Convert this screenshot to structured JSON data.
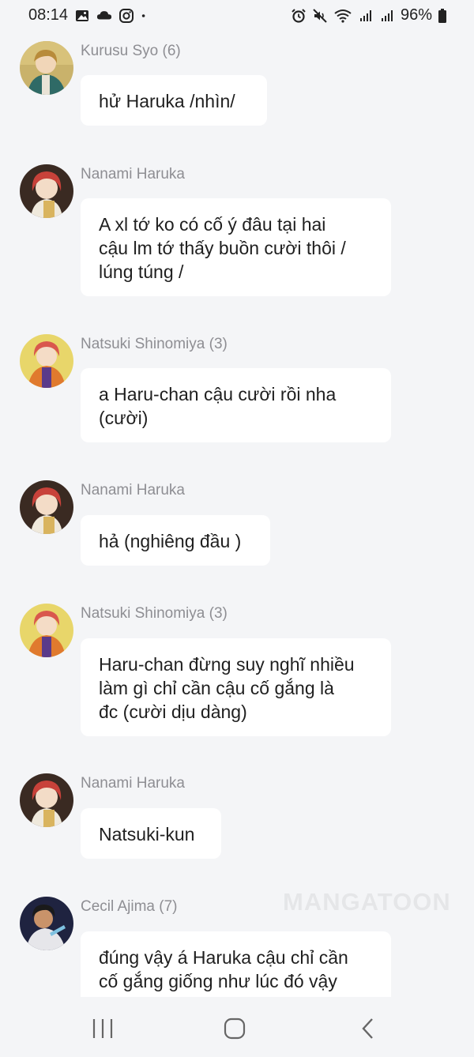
{
  "status_bar": {
    "time": "08:14",
    "battery": "96%",
    "left_icons": [
      "gallery-icon",
      "cloud-icon",
      "instagram-icon",
      "dot-icon"
    ],
    "right_icons": [
      "alarm-icon",
      "mute-icon",
      "wifi-icon",
      "signal-icon",
      "signal-icon",
      "battery-icon"
    ]
  },
  "messages": [
    {
      "sender": "Kurusu Syo (6)",
      "text": "hử Haruka /nhìn/"
    },
    {
      "sender": "Nanami Haruka",
      "text": "A xl tớ ko có cố ý đâu tại hai\ncậu lm tớ thấy buồn cười thôi /\nlúng túng /"
    },
    {
      "sender": "Natsuki Shinomiya (3)",
      "text": "a Haru-chan cậu cười rồi nha\n(cười)"
    },
    {
      "sender": "Nanami Haruka",
      "text": "hả (nghiêng đầu )"
    },
    {
      "sender": "Natsuki Shinomiya (3)",
      "text": "Haru-chan đừng suy nghĩ nhiều\nlàm gì chỉ cần cậu cố gắng là\nđc (cười dịu dàng)"
    },
    {
      "sender": "Nanami Haruka",
      "text": "Natsuki-kun"
    },
    {
      "sender": "Cecil Ajima (7)",
      "text": "đúng vậy á Haruka cậu chỉ cần\ncố gắng giống như lúc đó vậy\n(cười)"
    }
  ],
  "watermark": "MANGATOON",
  "colors": {
    "background": "#f4f5f7",
    "bubble": "#ffffff",
    "sender_name": "#8e8e93"
  }
}
